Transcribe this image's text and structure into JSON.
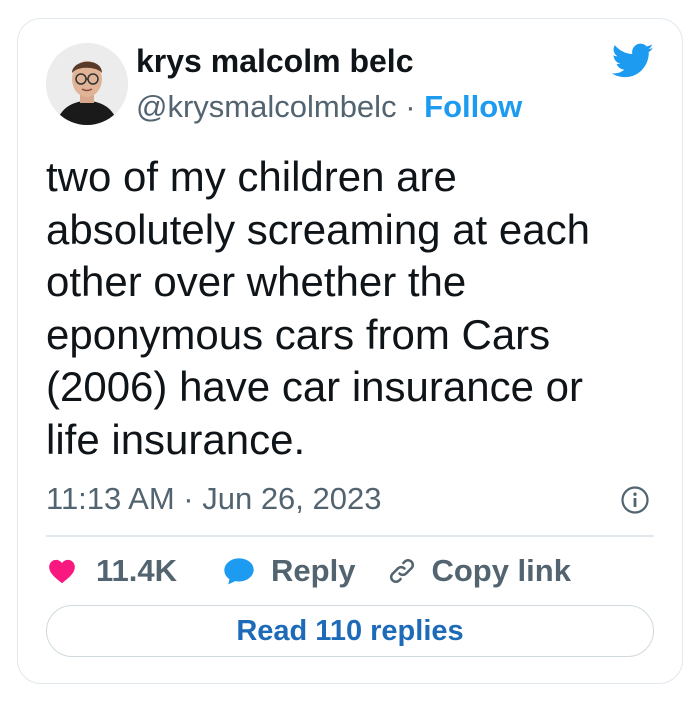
{
  "author": {
    "name": "krys malcolm belc",
    "handle": "@krysmalcolmbelc",
    "separator": " · ",
    "follow_label": "Follow"
  },
  "tweet": {
    "lines": [
      "two of my children are",
      "absolutely screaming at each",
      "other over whether the",
      "eponymous cars from Cars",
      "(2006) have car insurance or",
      "life insurance."
    ],
    "timestamp": "11:13 AM · Jun 26, 2023"
  },
  "actions": {
    "like_count": "11.4K",
    "reply_label": "Reply",
    "copy_link_label": "Copy link"
  },
  "read_replies_label": "Read 110 replies",
  "icons": {
    "brand": "twitter-bird-icon",
    "like": "heart-icon",
    "reply": "speech-bubble-icon",
    "copy": "link-icon",
    "info": "info-icon"
  },
  "colors": {
    "accent": "#1d9bf0",
    "like": "#f91880",
    "reply_icon": "#1d9bf0",
    "muted_text": "#536471",
    "read_replies_text": "#1d6ab8",
    "border": "#e1e8ed"
  }
}
